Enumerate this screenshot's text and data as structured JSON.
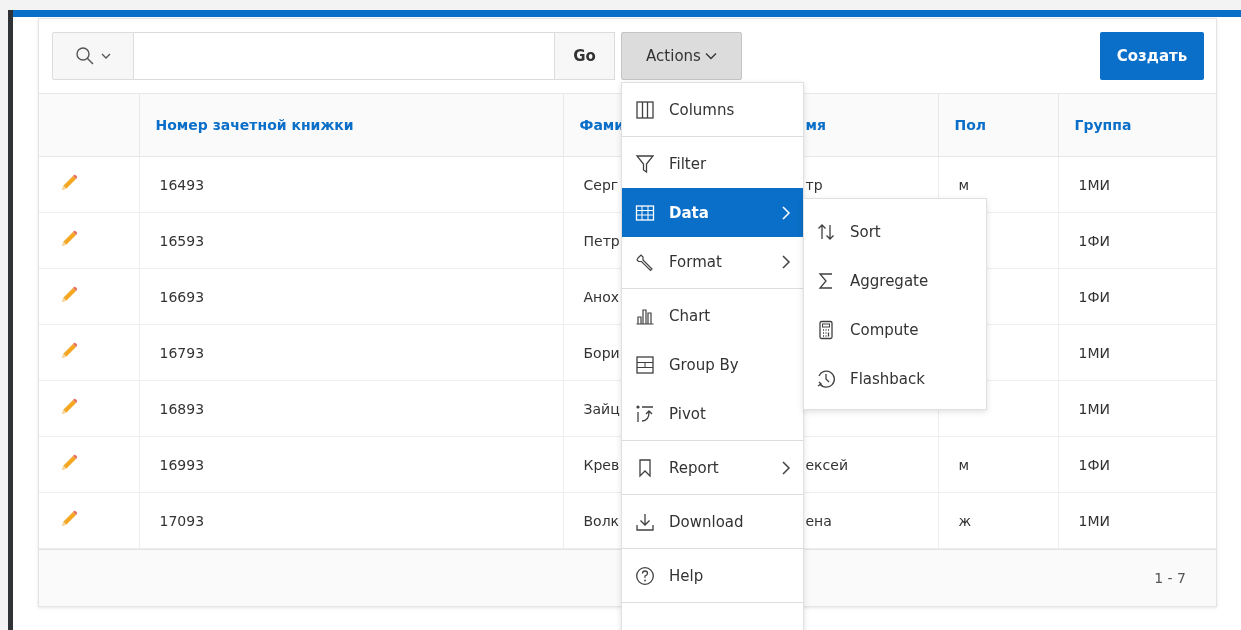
{
  "toolbar": {
    "go_button": "Go",
    "actions_button": "Actions",
    "create_button": "Создать"
  },
  "table": {
    "columns": [
      "Номер зачетной книжки",
      "Фами",
      "мя",
      "Пол",
      "Группа"
    ],
    "rows": [
      {
        "number": "16493",
        "surname": "Серг",
        "name": "тр",
        "sex": "м",
        "group": "1МИ"
      },
      {
        "number": "16593",
        "surname": "Петр",
        "group": "1ФИ"
      },
      {
        "number": "16693",
        "surname": "Анох",
        "group": "1ФИ"
      },
      {
        "number": "16793",
        "surname": "Бори",
        "group": "1МИ"
      },
      {
        "number": "16893",
        "surname": "Зайц",
        "group": "1МИ"
      },
      {
        "number": "16993",
        "surname": "Крев",
        "name": "ексей",
        "sex": "м",
        "group": "1ФИ"
      },
      {
        "number": "17093",
        "surname": "Волк",
        "name": "ена",
        "sex": "ж",
        "group": "1МИ"
      }
    ],
    "pagination": "1 - 7"
  },
  "actions_menu": {
    "groups": [
      [
        {
          "label": "Columns",
          "submenu_arrow": false,
          "selected": false
        }
      ],
      [
        {
          "label": "Filter",
          "submenu_arrow": false,
          "selected": false
        },
        {
          "label": "Data",
          "submenu_arrow": true,
          "selected": true,
          "submenu": [
            "Sort",
            "Aggregate",
            "Compute",
            "Flashback"
          ]
        },
        {
          "label": "Format",
          "submenu_arrow": true,
          "selected": false
        }
      ],
      [
        {
          "label": "Chart",
          "submenu_arrow": false,
          "selected": false
        },
        {
          "label": "Group By",
          "submenu_arrow": false,
          "selected": false
        },
        {
          "label": "Pivot",
          "submenu_arrow": false,
          "selected": false
        }
      ],
      [
        {
          "label": "Report",
          "submenu_arrow": true,
          "selected": false
        }
      ],
      [
        {
          "label": "Download",
          "submenu_arrow": false,
          "selected": false
        }
      ],
      [
        {
          "label": "Help",
          "submenu_arrow": false,
          "selected": false
        }
      ]
    ]
  }
}
